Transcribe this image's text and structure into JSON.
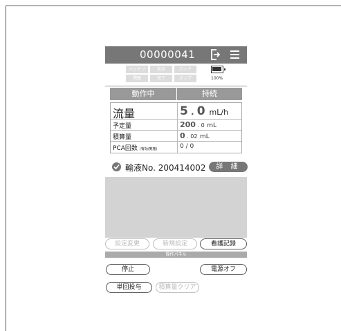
{
  "header": {
    "device_number": "00000041",
    "logout_icon": "logout-icon",
    "menu_icon": "hamburger-menu-icon"
  },
  "status_indicators": [
    {
      "label": "バッテリ"
    },
    {
      "label": "気泡"
    },
    {
      "label": "ロック"
    },
    {
      "label": "閉塞"
    },
    {
      "label": "完了"
    },
    {
      "label": "ポンプ"
    }
  ],
  "battery": {
    "percent_text": "100%",
    "level": 1.0
  },
  "status": {
    "state": "動作中",
    "mode": "持続"
  },
  "readings": {
    "flow": {
      "label": "流量",
      "value_int": "5",
      "value_dec": "0",
      "unit": "mL/h"
    },
    "scheduled": {
      "label": "予定量",
      "value_int": "200",
      "value_dec": "0",
      "unit": "mL"
    },
    "accumulated": {
      "label": "積算量",
      "value_int": "0",
      "value_dec": "02",
      "unit": "mL"
    },
    "pca": {
      "label": "PCA回数",
      "sublabel": "(有効/実施)",
      "value": "0 / 0"
    }
  },
  "infusion": {
    "check_icon": "check-circle-icon",
    "text": "輸液No. 200414002",
    "detail_label": "詳 細"
  },
  "operations": {
    "change_settings": "設定変更",
    "new_settings": "新規設定",
    "nursing_record": "看護記録",
    "panel_label": "操作パネル",
    "stop": "停止",
    "power_off": "電源オフ",
    "single_dose": "単回投与",
    "clear_accumulated": "積算量クリア"
  },
  "colors": {
    "header_bg": "#777777",
    "panel_header": "#999999",
    "disabled": "#bbbbbb"
  }
}
